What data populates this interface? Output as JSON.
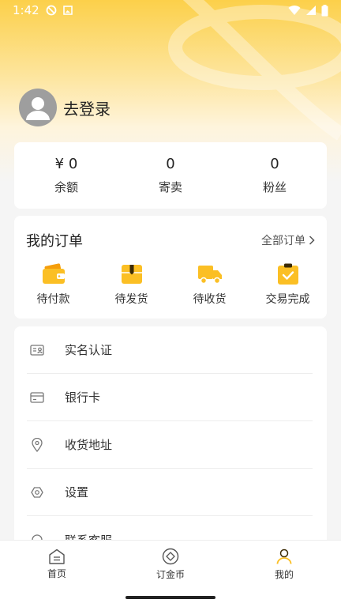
{
  "status_bar": {
    "time": "1:42"
  },
  "profile": {
    "login_label": "去登录"
  },
  "stats": [
    {
      "value": "¥ 0",
      "label": "余额"
    },
    {
      "value": "0",
      "label": "寄卖"
    },
    {
      "value": "0",
      "label": "粉丝"
    }
  ],
  "orders": {
    "title": "我的订单",
    "all_label": "全部订单",
    "items": [
      {
        "label": "待付款",
        "icon": "wallet-icon"
      },
      {
        "label": "待发货",
        "icon": "package-icon"
      },
      {
        "label": "待收货",
        "icon": "truck-icon"
      },
      {
        "label": "交易完成",
        "icon": "clipboard-check-icon"
      }
    ]
  },
  "menu": [
    {
      "label": "实名认证",
      "icon": "id-card-icon"
    },
    {
      "label": "银行卡",
      "icon": "bank-card-icon"
    },
    {
      "label": "收货地址",
      "icon": "location-pin-icon"
    },
    {
      "label": "设置",
      "icon": "settings-icon"
    },
    {
      "label": "联系客服",
      "icon": "headset-icon"
    }
  ],
  "bottom_nav": [
    {
      "label": "首页",
      "icon": "home-icon"
    },
    {
      "label": "订金币",
      "icon": "coin-icon"
    },
    {
      "label": "我的",
      "icon": "user-icon",
      "active": true
    }
  ],
  "colors": {
    "accent": "#fbbf24",
    "header_top": "#fcd04a"
  }
}
